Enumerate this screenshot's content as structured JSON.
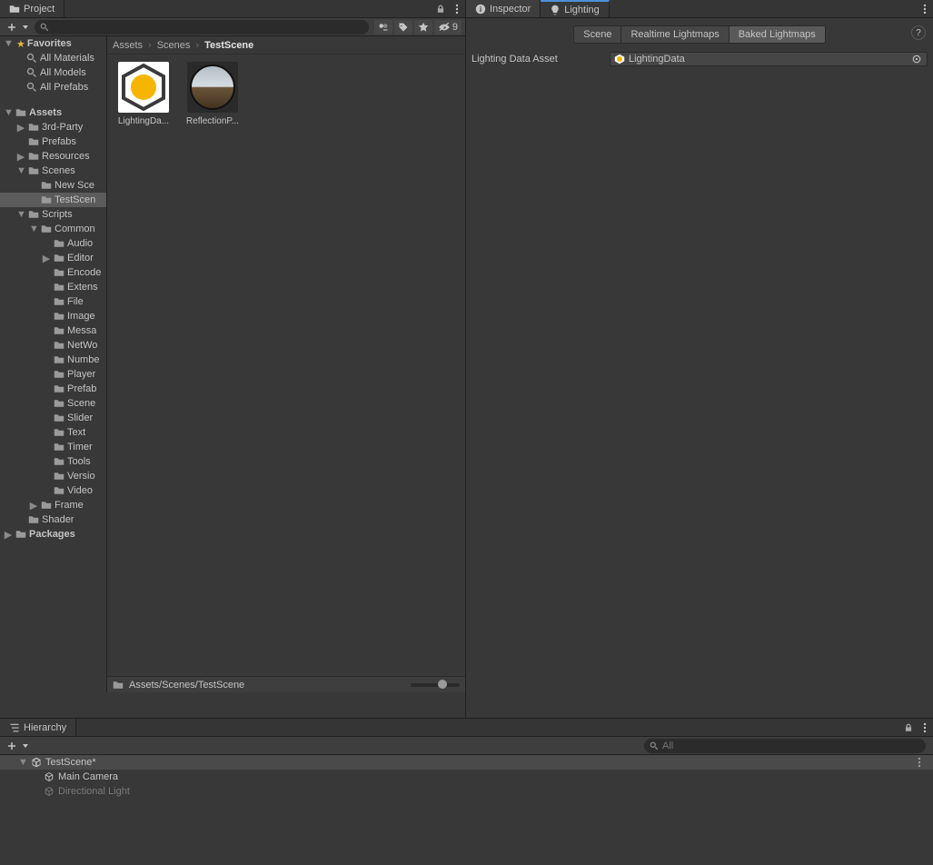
{
  "project": {
    "tab_label": "Project",
    "eye_count": "9",
    "breadcrumbs": [
      "Assets",
      "Scenes",
      "TestScene"
    ],
    "statusbar_path": "Assets/Scenes/TestScene",
    "search_placeholder": "",
    "favorites": {
      "label": "Favorites",
      "items": [
        "All Materials",
        "All Models",
        "All Prefabs"
      ]
    },
    "assets": {
      "label": "Assets",
      "children": [
        {
          "label": "3rd-Party",
          "expandable": true
        },
        {
          "label": "Prefabs"
        },
        {
          "label": "Resources",
          "expandable": true
        },
        {
          "label": "Scenes",
          "expandable": true,
          "expanded": true,
          "children": [
            {
              "label": "New Sce"
            },
            {
              "label": "TestScen",
              "selected": true
            }
          ]
        },
        {
          "label": "Scripts",
          "expandable": true,
          "expanded": true,
          "children": [
            {
              "label": "Common",
              "expandable": true,
              "expanded": true,
              "children": [
                {
                  "label": "Audio"
                },
                {
                  "label": "Editor",
                  "expandable": true
                },
                {
                  "label": "Encode"
                },
                {
                  "label": "Extens"
                },
                {
                  "label": "File"
                },
                {
                  "label": "Image"
                },
                {
                  "label": "Messa"
                },
                {
                  "label": "NetWo"
                },
                {
                  "label": "Numbe"
                },
                {
                  "label": "Player"
                },
                {
                  "label": "Prefab"
                },
                {
                  "label": "Scene"
                },
                {
                  "label": "Slider"
                },
                {
                  "label": "Text"
                },
                {
                  "label": "Timer"
                },
                {
                  "label": "Tools"
                },
                {
                  "label": "Versio"
                },
                {
                  "label": "Video"
                }
              ]
            },
            {
              "label": "Frame",
              "expandable": true
            }
          ]
        },
        {
          "label": "Shader"
        }
      ]
    },
    "packages_label": "Packages",
    "grid_items": [
      {
        "label": "LightingDa...",
        "kind": "lightingdata"
      },
      {
        "label": "ReflectionP...",
        "kind": "reflection"
      }
    ]
  },
  "inspector": {
    "tab_label": "Inspector"
  },
  "lighting": {
    "tab_label": "Lighting",
    "segments": [
      "Scene",
      "Realtime Lightmaps",
      "Baked Lightmaps"
    ],
    "active_segment": 2,
    "prop_label": "Lighting Data Asset",
    "prop_value": "LightingData"
  },
  "hierarchy": {
    "tab_label": "Hierarchy",
    "search_placeholder": "All",
    "scene": "TestScene*",
    "items": [
      {
        "label": "Main Camera"
      },
      {
        "label": "Directional Light",
        "faded": true
      }
    ]
  }
}
